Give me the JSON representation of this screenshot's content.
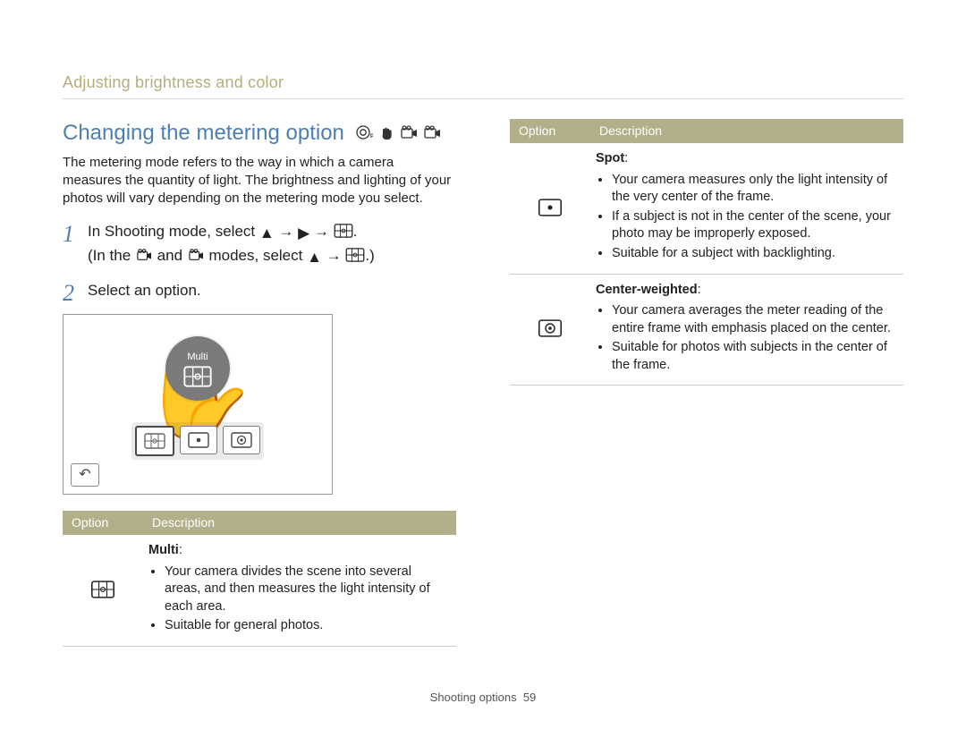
{
  "section_label": "Adjusting brightness and color",
  "heading": "Changing the metering option",
  "intro": "The metering mode refers to the way in which a camera measures the quantity of light. The brightness and lighting of your photos will vary depending on the metering mode you select.",
  "steps": [
    {
      "text_a": "In Shooting mode, select ",
      "seq1": [
        "up-triangle-icon",
        "arrow",
        "right-triangle-icon",
        "arrow",
        "metering-multi-icon"
      ],
      "text_b": ".",
      "sub_a": "(In the ",
      "sub_mid": " and ",
      "sub_b": " modes, select ",
      "seq2": [
        "up-triangle-icon",
        "arrow",
        "metering-multi-icon"
      ],
      "sub_c": ".)"
    },
    {
      "text_a": "Select an option."
    }
  ],
  "diagram": {
    "bubble_label": "Multi"
  },
  "mode_icons": [
    "p-mode-icon",
    "hand-mode-icon",
    "video-mode-icon",
    "smart-video-mode-icon"
  ],
  "table_headers": {
    "option": "Option",
    "description": "Description"
  },
  "table_left": [
    {
      "icon": "metering-multi-icon",
      "title": "Multi",
      "bullets": [
        "Your camera divides the scene into several areas, and then measures the light intensity of each area.",
        "Suitable for general photos."
      ]
    }
  ],
  "table_right": [
    {
      "icon": "metering-spot-icon",
      "title": "Spot",
      "bullets": [
        "Your camera measures only the light intensity of the very center of the frame.",
        "If a subject is not in the center of the scene, your photo may be improperly exposed.",
        "Suitable for a subject with backlighting."
      ]
    },
    {
      "icon": "metering-center-icon",
      "title": "Center-weighted",
      "bullets": [
        "Your camera averages the meter reading of the entire frame with emphasis placed on the center.",
        "Suitable for photos with subjects in the center of the frame."
      ]
    }
  ],
  "footer": {
    "label": "Shooting options",
    "page": "59"
  }
}
